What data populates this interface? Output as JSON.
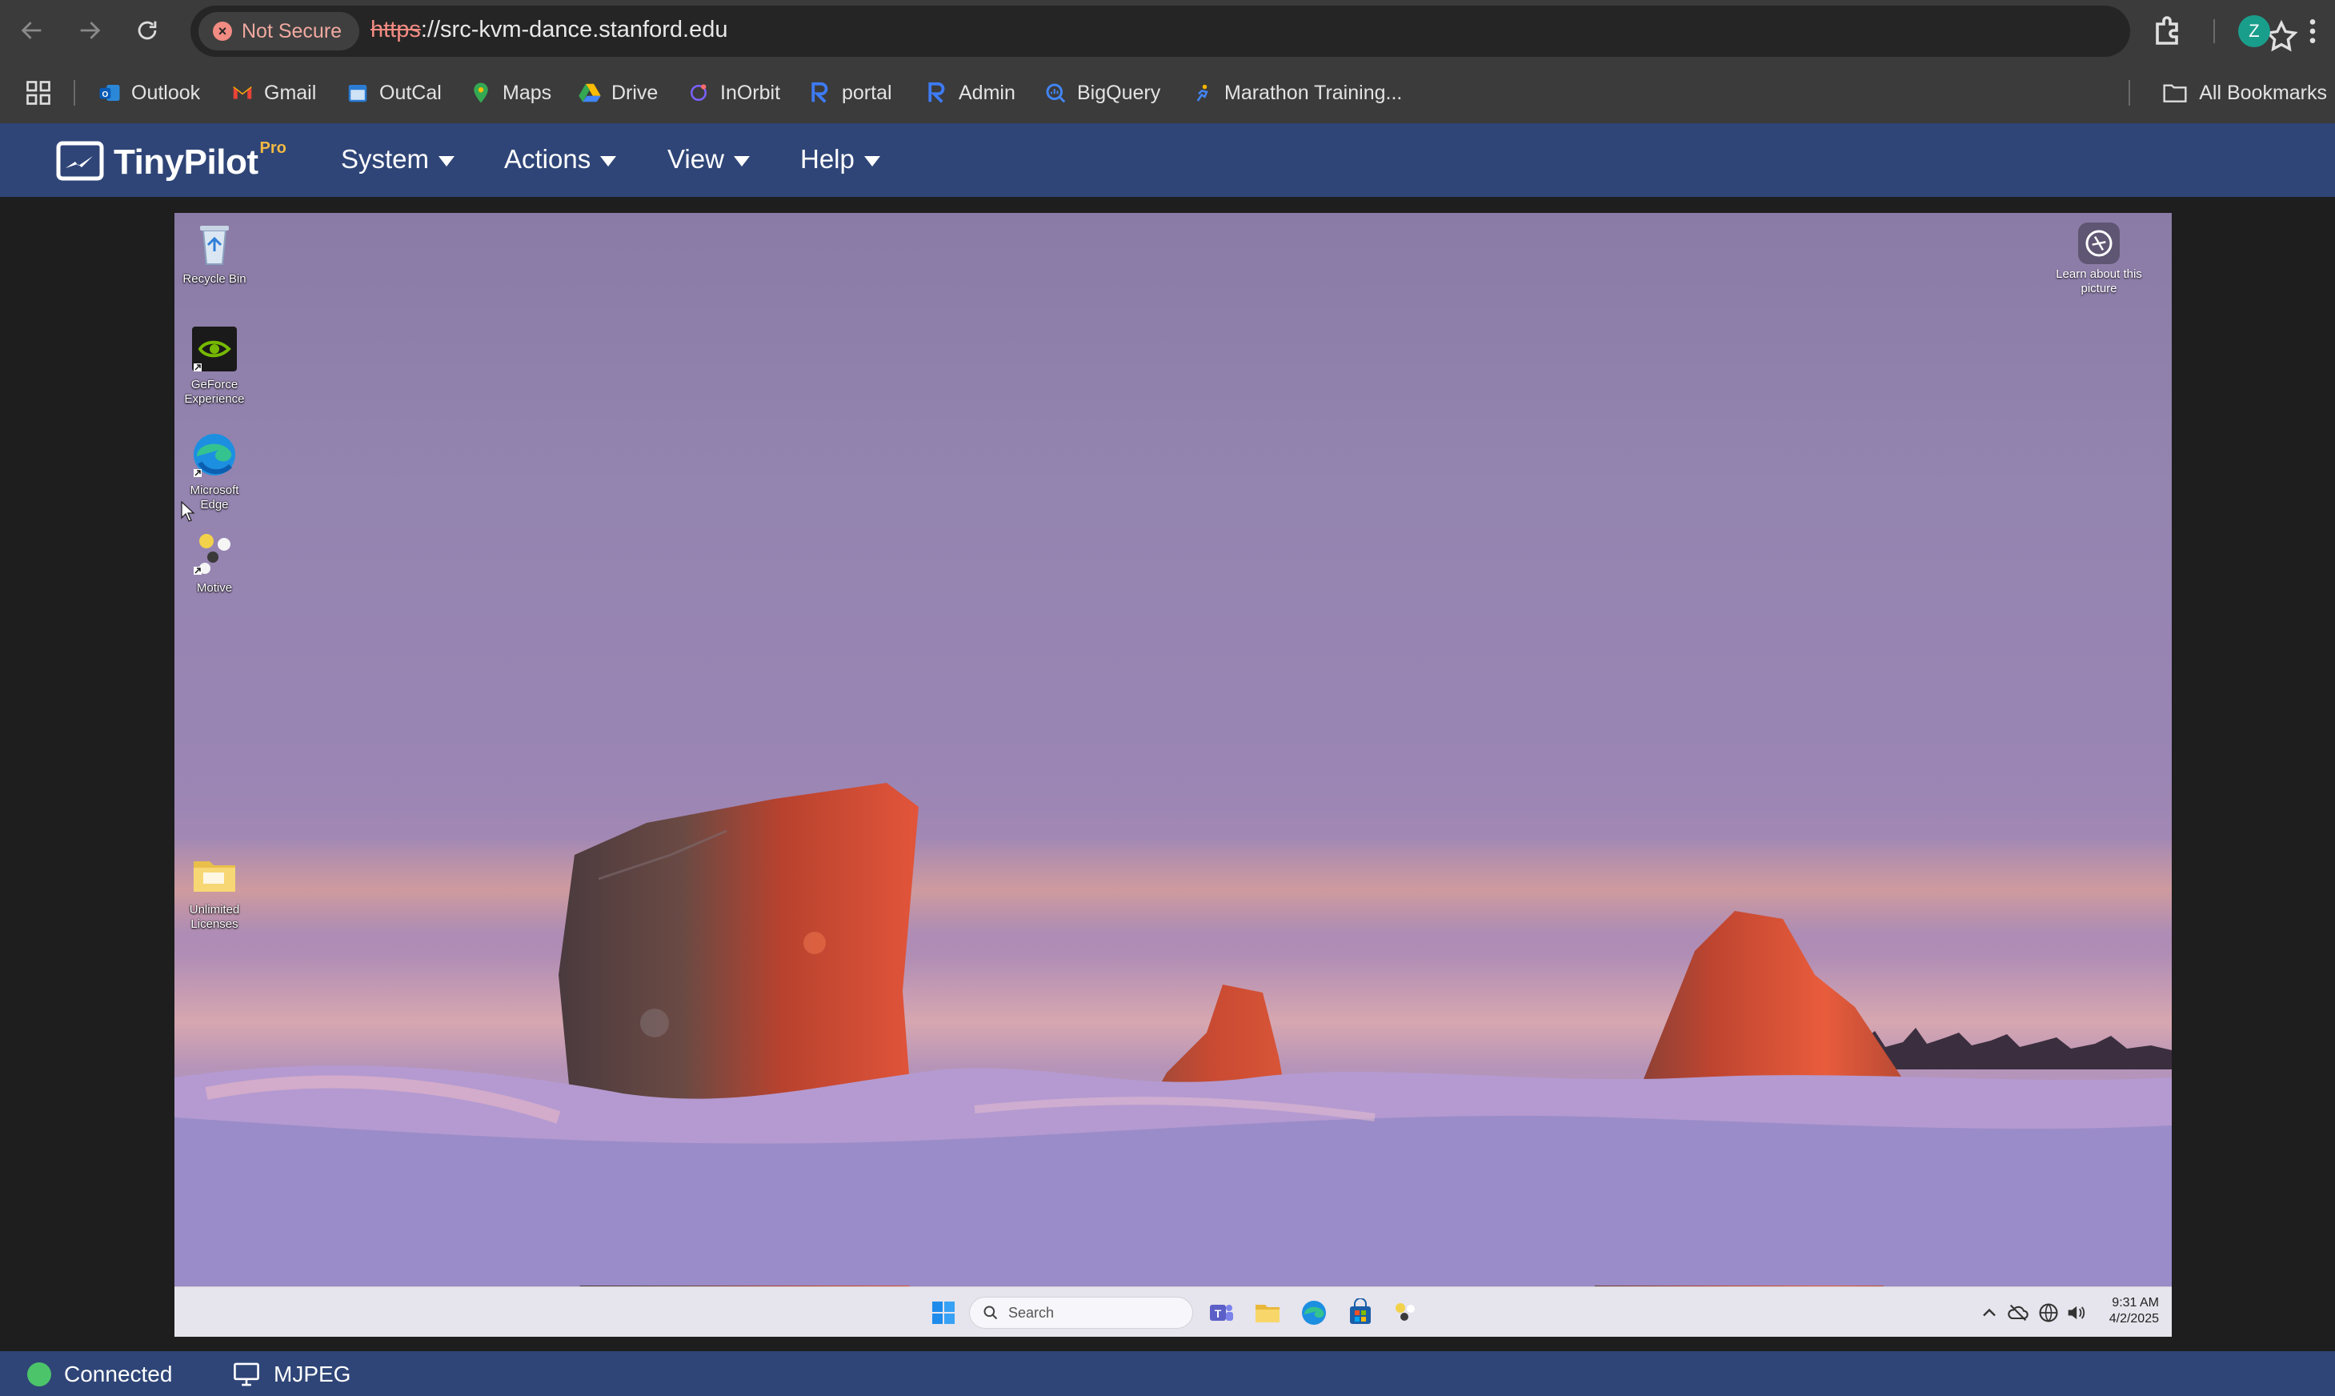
{
  "browser": {
    "security_label": "Not Secure",
    "url_scheme": "https",
    "url_rest": "://src-kvm-dance.stanford.edu",
    "profile_initial": "Z",
    "bookmarks": [
      {
        "label": "Outlook",
        "icon": "outlook-icon",
        "color": "#1a73e8"
      },
      {
        "label": "Gmail",
        "icon": "gmail-icon",
        "color": "#ea4335"
      },
      {
        "label": "OutCal",
        "icon": "calendar-icon",
        "color": "#2b7cd3"
      },
      {
        "label": "Maps",
        "icon": "maps-icon",
        "color": "#34a853"
      },
      {
        "label": "Drive",
        "icon": "drive-icon",
        "color": "#fbbc04"
      },
      {
        "label": "InOrbit",
        "icon": "inorbit-icon",
        "color": "#7b61ff"
      },
      {
        "label": "portal",
        "icon": "r-logo-icon",
        "color": "#3d7bf7"
      },
      {
        "label": "Admin",
        "icon": "r-logo-icon",
        "color": "#3d7bf7"
      },
      {
        "label": "BigQuery",
        "icon": "bigquery-icon",
        "color": "#4285f4"
      },
      {
        "label": "Marathon Training...",
        "icon": "runner-icon",
        "color": "#f4b400"
      }
    ],
    "all_bookmarks": "All Bookmarks"
  },
  "tinypilot": {
    "brand": "TinyPilot",
    "badge": "Pro",
    "menu": {
      "system": "System",
      "actions": "Actions",
      "view": "View",
      "help": "Help"
    }
  },
  "desktop": {
    "icons": {
      "recycle_bin": "Recycle Bin",
      "geforce": "GeForce Experience",
      "edge": "Microsoft Edge",
      "motive": "Motive",
      "licenses": "Unlimited Licenses"
    },
    "learn_label": "Learn about this picture",
    "taskbar": {
      "search_placeholder": "Search",
      "time": "9:31 AM",
      "date": "4/2/2025"
    }
  },
  "status": {
    "connection": "Connected",
    "stream_mode": "MJPEG",
    "connected_color": "#4cc46a"
  }
}
